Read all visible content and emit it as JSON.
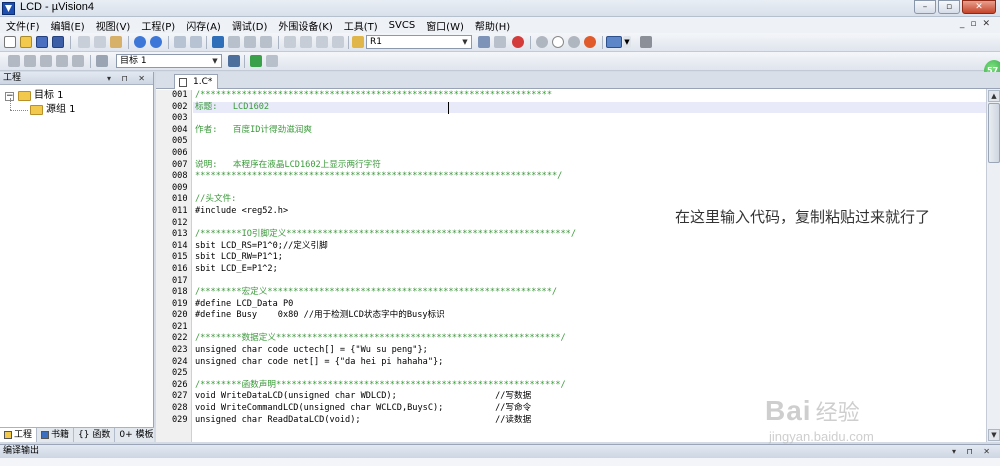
{
  "window": {
    "title": "LCD - µVision4"
  },
  "menu": [
    "文件(F)",
    "编辑(E)",
    "视图(V)",
    "工程(P)",
    "闪存(A)",
    "调试(D)",
    "外围设备(K)",
    "工具(T)",
    "SVCS",
    "窗口(W)",
    "帮助(H)"
  ],
  "toolbar": {
    "find_combo": "R1",
    "target_combo": "目标 1"
  },
  "project": {
    "title": "工程",
    "tree": {
      "target": "目标 1",
      "group": "源组 1"
    },
    "tabs": [
      "工程",
      "书籍",
      "{} 函数",
      "0+ 模板"
    ]
  },
  "editor": {
    "tab": "1.C*",
    "line_numbers": [
      "001",
      "002",
      "003",
      "004",
      "005",
      "006",
      "007",
      "008",
      "009",
      "010",
      "011",
      "012",
      "013",
      "014",
      "015",
      "016",
      "017",
      "018",
      "019",
      "020",
      "021",
      "022",
      "023",
      "024",
      "025",
      "026",
      "027",
      "028",
      "029"
    ],
    "lines": [
      "/********************************************************************",
      "标题:   LCD1602",
      "",
      "作者:   百度ID计得劲滋润爽",
      "",
      "",
      "说明:   本程序在液晶LCD1602上显示两行字符",
      "**********************************************************************/",
      "",
      "//头文件:",
      "#include <reg52.h>",
      "",
      "/********IO引脚定义*******************************************************/",
      "sbit LCD_RS=P1^0;//定义引脚",
      "sbit LCD_RW=P1^1;",
      "sbit LCD_E=P1^2;",
      "",
      "/********宏定义*******************************************************/",
      "#define LCD_Data P0",
      "#define Busy    0x80 //用于检测LCD状态字中的Busy标识",
      "",
      "/********数据定义*******************************************************/",
      "unsigned char code uctech[] = {\"Wu su peng\"};",
      "unsigned char code net[] = {\"da hei pi hahaha\"};",
      "",
      "/********函数声明*******************************************************/",
      "void WriteDataLCD(unsigned char WDLCD);                   //写数据",
      "void WriteCommandLCD(unsigned char WCLCD,BuysC);          //写命令",
      "unsigned char ReadDataLCD(void);                          //读数据"
    ]
  },
  "annotation": "在这里输入代码，复制粘贴过来就行了",
  "output": {
    "title": "编译输出"
  },
  "badge": "57",
  "watermark": {
    "brand": "Bai",
    "brand2": "经验",
    "url": "jingyan.baidu.com"
  }
}
